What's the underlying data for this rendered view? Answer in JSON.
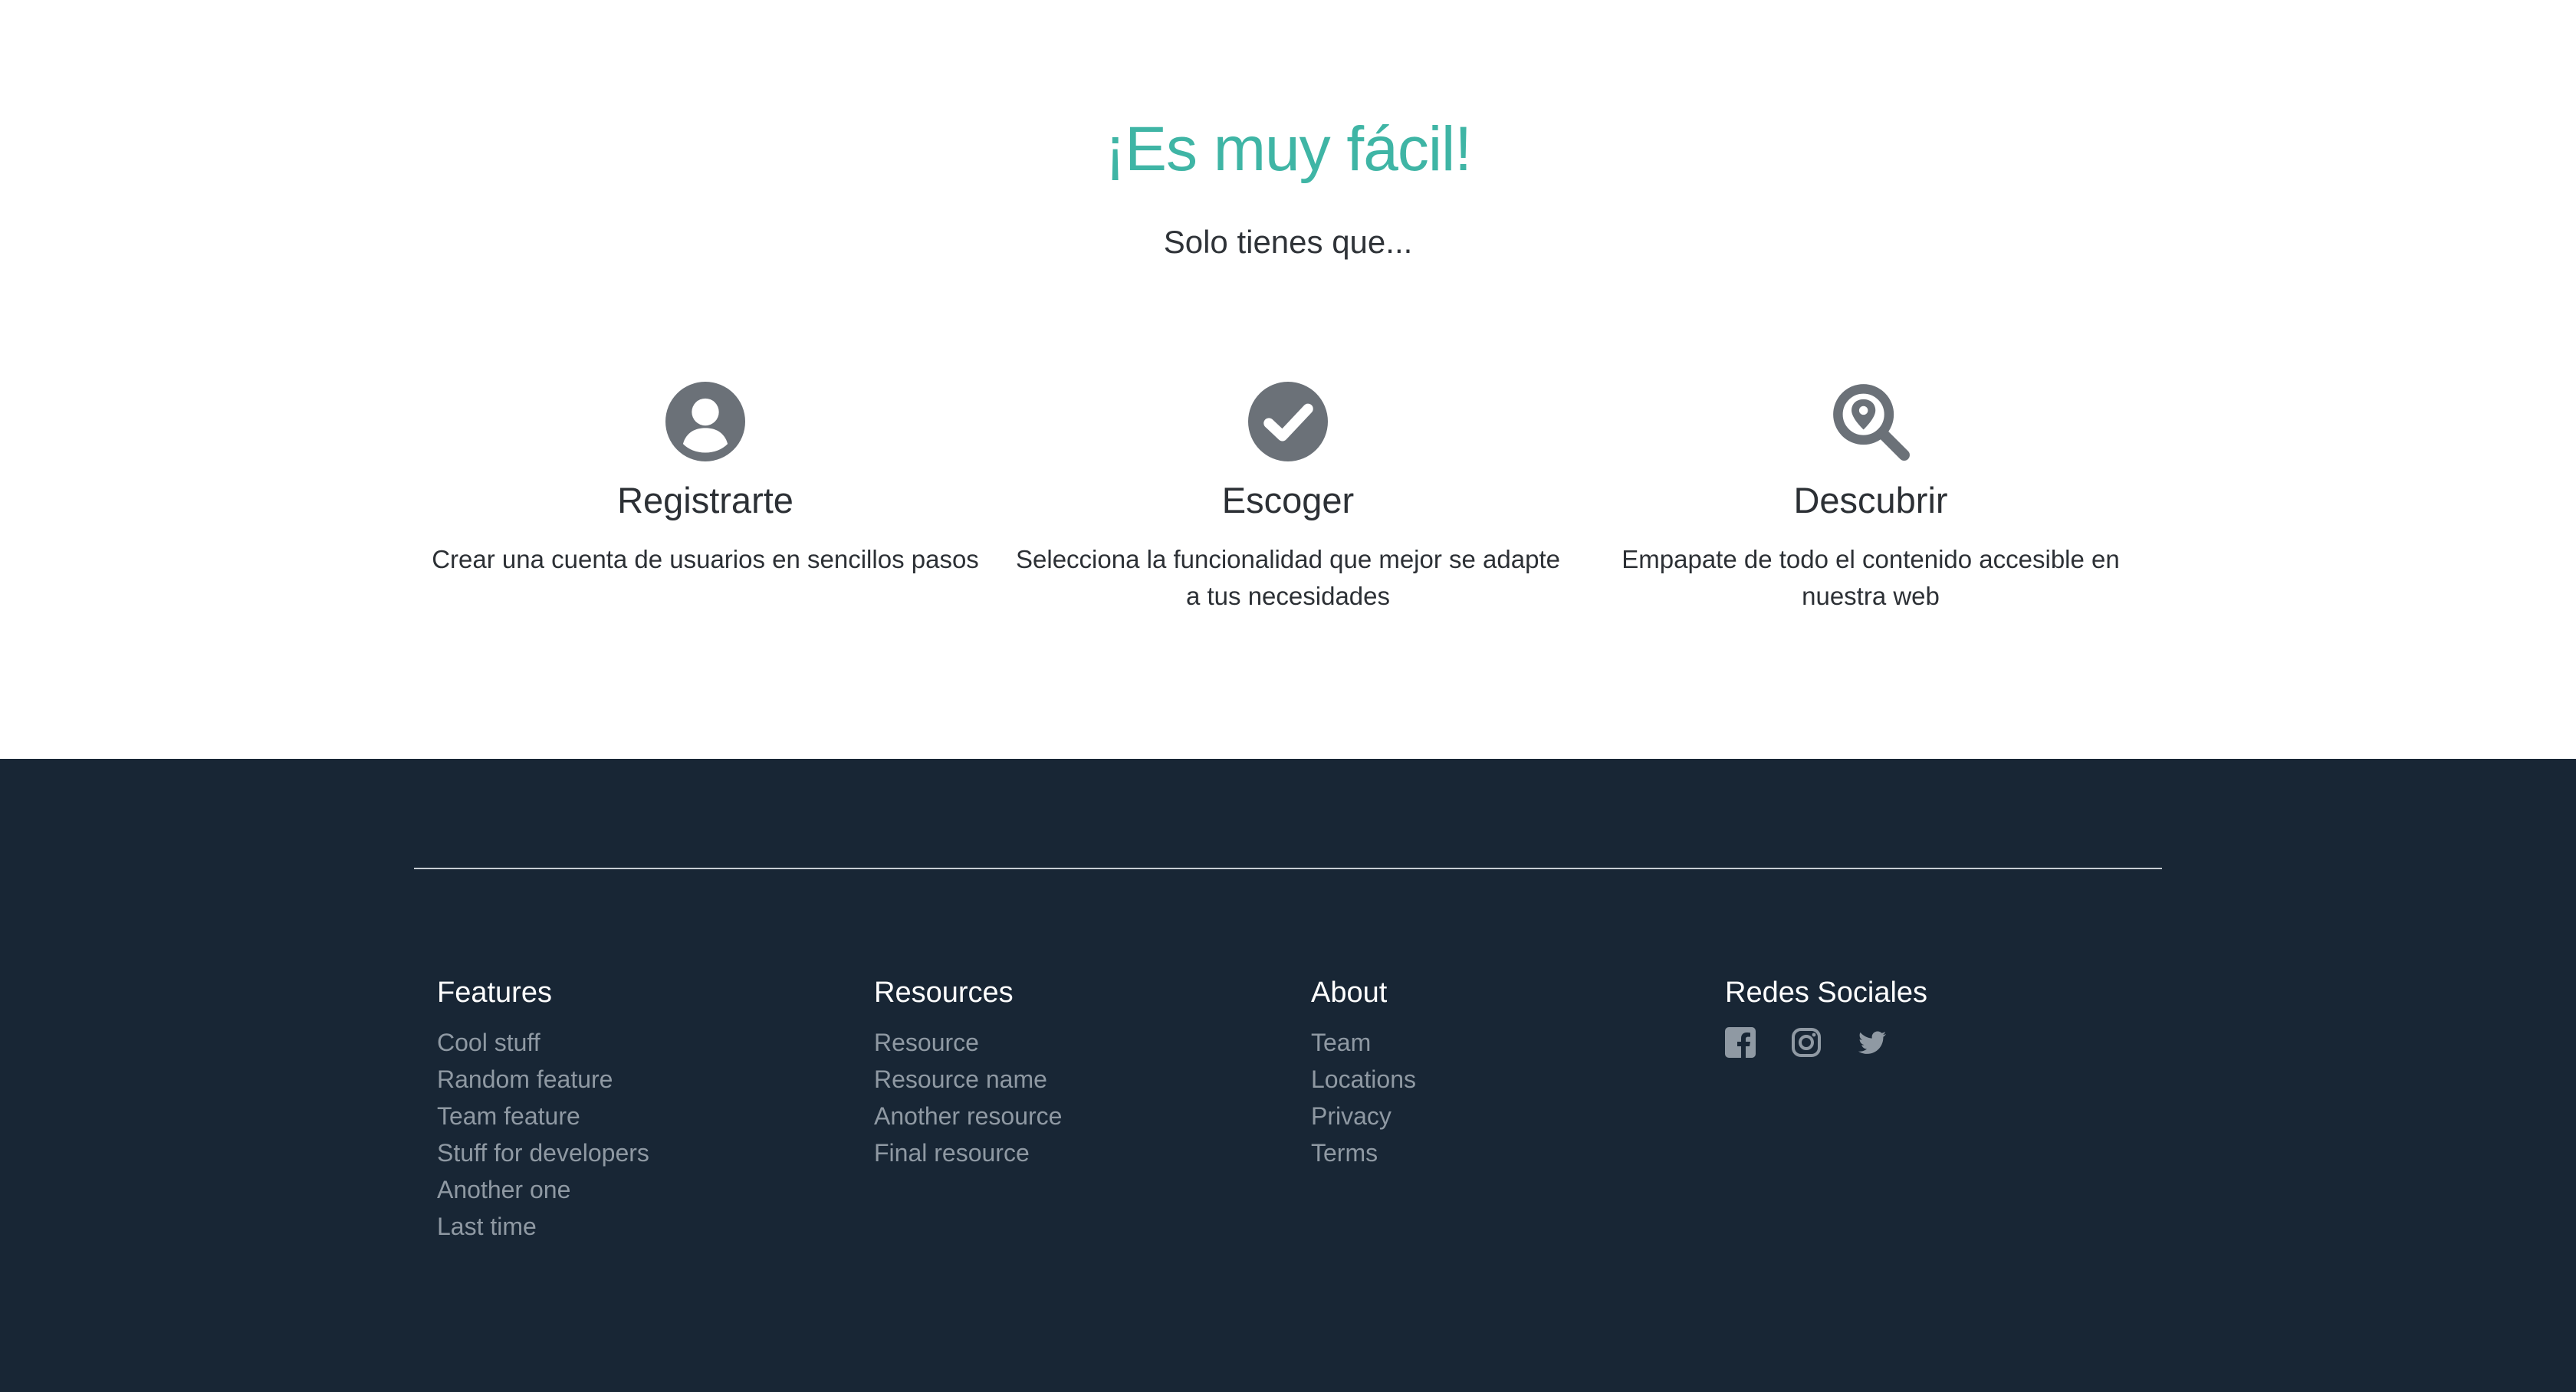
{
  "hero": {
    "title": "¡Es muy fácil!",
    "subtitle": "Solo tienes que..."
  },
  "features": [
    {
      "icon": "user-circle-icon",
      "title": "Registrarte",
      "text": "Crear una cuenta de usuarios en sencillos pasos"
    },
    {
      "icon": "check-circle-icon",
      "title": "Escoger",
      "text": "Selecciona la funcionalidad que mejor se adapte a tus necesidades"
    },
    {
      "icon": "search-location-icon",
      "title": "Descubrir",
      "text": "Empapate de todo el contenido accesible en nuestra web"
    }
  ],
  "footer": {
    "columns": [
      {
        "heading": "Features",
        "links": [
          "Cool stuff",
          "Random feature",
          "Team feature",
          "Stuff for developers",
          "Another one",
          "Last time"
        ]
      },
      {
        "heading": "Resources",
        "links": [
          "Resource",
          "Resource name",
          "Another resource",
          "Final resource"
        ]
      },
      {
        "heading": "About",
        "links": [
          "Team",
          "Locations",
          "Privacy",
          "Terms"
        ]
      }
    ],
    "social": {
      "heading": "Redes Sociales",
      "icons": [
        "facebook-icon",
        "instagram-icon",
        "twitter-icon"
      ]
    }
  },
  "colors": {
    "accent": "#3fb5a5",
    "footer_bg": "#182635",
    "icon_gray": "#6b7178",
    "footer_link": "#8f99a3"
  }
}
